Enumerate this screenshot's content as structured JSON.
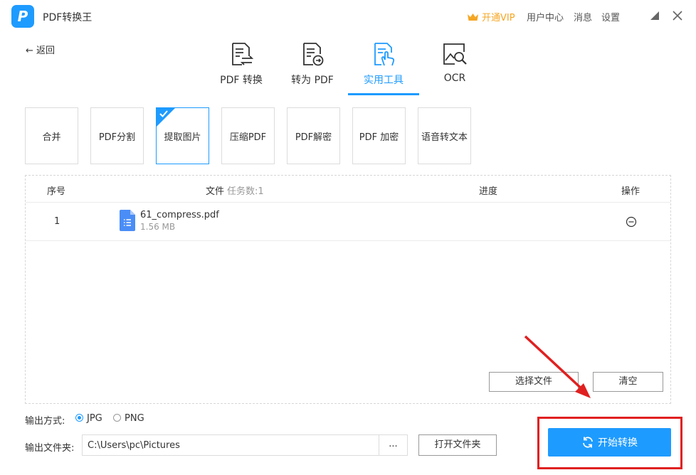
{
  "window": {
    "title": "PDF转换王",
    "logo_glyph": "P",
    "vip_label": "开通VIP",
    "nav": [
      "用户中心",
      "消息",
      "设置"
    ]
  },
  "back_label": "返回",
  "tabs": [
    {
      "label": "PDF 转换",
      "icon": "pdf-convert-icon"
    },
    {
      "label": "转为 PDF",
      "icon": "to-pdf-icon"
    },
    {
      "label": "实用工具",
      "icon": "tools-icon",
      "active": true
    },
    {
      "label": "OCR",
      "icon": "ocr-icon"
    }
  ],
  "tools": [
    {
      "label": "合并"
    },
    {
      "label": "PDF分割"
    },
    {
      "label": "提取图片",
      "active": true
    },
    {
      "label": "压缩PDF"
    },
    {
      "label": "PDF解密"
    },
    {
      "label": "PDF 加密"
    },
    {
      "label": "语音转文本"
    }
  ],
  "table": {
    "col_index": "序号",
    "col_file": "文件",
    "task_count": "任务数:1",
    "col_progress": "进度",
    "col_action": "操作",
    "rows": [
      {
        "index": "1",
        "name": "61_compress.pdf",
        "size": "1.56 MB"
      }
    ]
  },
  "buttons": {
    "select_file": "选择文件",
    "clear": "清空",
    "open_folder": "打开文件夹",
    "browse": "...",
    "start": "开始转换"
  },
  "output": {
    "format_label": "输出方式:",
    "formats": [
      {
        "label": "JPG",
        "checked": true
      },
      {
        "label": "PNG",
        "checked": false
      }
    ],
    "folder_label": "输出文件夹:",
    "folder_path": "C:\\Users\\pc\\Pictures"
  },
  "colors": {
    "accent": "#1E9BFF",
    "vip": "#F5A623",
    "annotation": "#E02020"
  }
}
